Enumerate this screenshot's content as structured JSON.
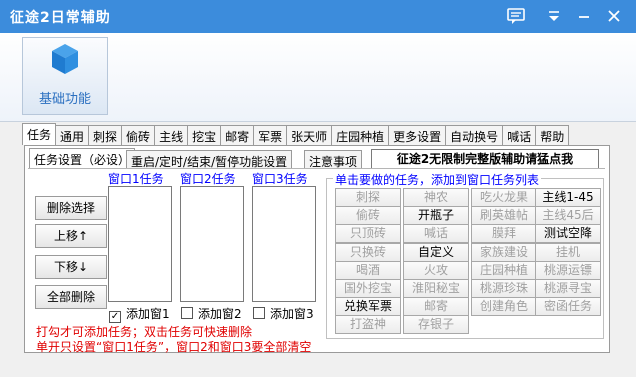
{
  "window": {
    "title": "征途2日常辅助",
    "title_bg": "#3c8cdc"
  },
  "ribbon": {
    "button_label": "基础功能",
    "icon": "cube-icon"
  },
  "main_tabs": [
    "任务",
    "通用",
    "刺探",
    "偷砖",
    "主线",
    "挖宝",
    "邮寄",
    "军票",
    "张天师",
    "庄园种植",
    "更多设置",
    "自动换号",
    "喊话",
    "帮助"
  ],
  "active_main_tab": 0,
  "sub_tabs": [
    "任务设置（必设）",
    "重启/定时/结束/暂停功能设置",
    "注意事项"
  ],
  "active_sub_tab": 0,
  "promo_label": "征途2无限制完整版辅助请猛点我",
  "windows": {
    "labels": [
      "窗口1任务",
      "窗口2任务",
      "窗口3任务"
    ],
    "checkboxes": [
      {
        "label": "添加窗1",
        "checked": true
      },
      {
        "label": "添加窗2",
        "checked": false
      },
      {
        "label": "添加窗3",
        "checked": false
      }
    ]
  },
  "left_buttons": [
    "删除选择",
    "上移↑",
    "下移↓",
    "全部删除"
  ],
  "notes": [
    "打勾才可添加任务；双击任务可快速删除",
    "单开只设置“窗口1任务”，窗口2和窗口3要全部清空"
  ],
  "task_group": {
    "title": "单击要做的任务，添加到窗口任务列表",
    "rows": [
      [
        {
          "label": "刺探",
          "enabled": false
        },
        {
          "label": "神农",
          "enabled": false
        },
        {
          "label": "吃火龙果",
          "enabled": false
        },
        {
          "label": "主线1-45",
          "enabled": true
        }
      ],
      [
        {
          "label": "偷砖",
          "enabled": false
        },
        {
          "label": "开瓶子",
          "enabled": true
        },
        {
          "label": "刷英雄帖",
          "enabled": false
        },
        {
          "label": "主线45后",
          "enabled": false
        }
      ],
      [
        {
          "label": "只顶砖",
          "enabled": false
        },
        {
          "label": "喊话",
          "enabled": false
        },
        {
          "label": "膜拜",
          "enabled": false
        },
        {
          "label": "测试空降",
          "enabled": true
        }
      ],
      [
        {
          "label": "只换砖",
          "enabled": false
        },
        {
          "label": "自定义",
          "enabled": true
        },
        {
          "label": "家族建设",
          "enabled": false
        },
        {
          "label": "挂机",
          "enabled": false
        }
      ],
      [
        {
          "label": "喝酒",
          "enabled": false
        },
        {
          "label": "火攻",
          "enabled": false
        },
        {
          "label": "庄园种植",
          "enabled": false
        },
        {
          "label": "桃源运镖",
          "enabled": false
        }
      ],
      [
        {
          "label": "国外挖宝",
          "enabled": false
        },
        {
          "label": "淮阳秘宝",
          "enabled": false
        },
        {
          "label": "桃源珍珠",
          "enabled": false
        },
        {
          "label": "桃源寻宝",
          "enabled": false
        }
      ],
      [
        {
          "label": "兑换军票",
          "enabled": true
        },
        {
          "label": "邮寄",
          "enabled": false
        },
        {
          "label": "创建角色",
          "enabled": false
        },
        {
          "label": "密函任务",
          "enabled": false
        }
      ],
      [
        {
          "label": "打盗神",
          "enabled": false
        },
        {
          "label": "存银子",
          "enabled": false
        }
      ]
    ]
  }
}
